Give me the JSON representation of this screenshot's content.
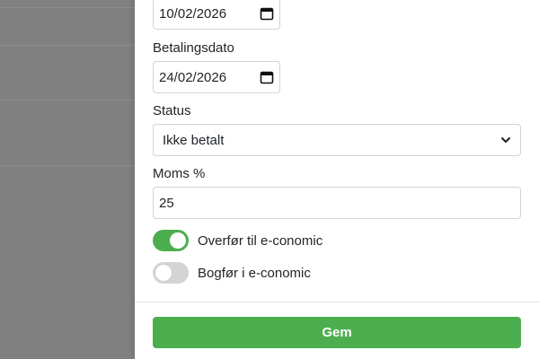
{
  "form": {
    "date_top_value": "10/02/2026",
    "payment_date": {
      "label": "Betalingsdato",
      "value": "24/02/2026"
    },
    "status": {
      "label": "Status",
      "value": "Ikke betalt"
    },
    "vat": {
      "label": "Moms %",
      "value": "25"
    },
    "toggles": {
      "transfer": {
        "label": "Overfør til e-conomic",
        "on": true
      },
      "book": {
        "label": "Bogfør i e-conomic",
        "on": false
      }
    },
    "save_label": "Gem"
  },
  "colors": {
    "accent_green": "#4cae4f",
    "backdrop": "#808080",
    "switch_off": "#d4d4d4"
  }
}
